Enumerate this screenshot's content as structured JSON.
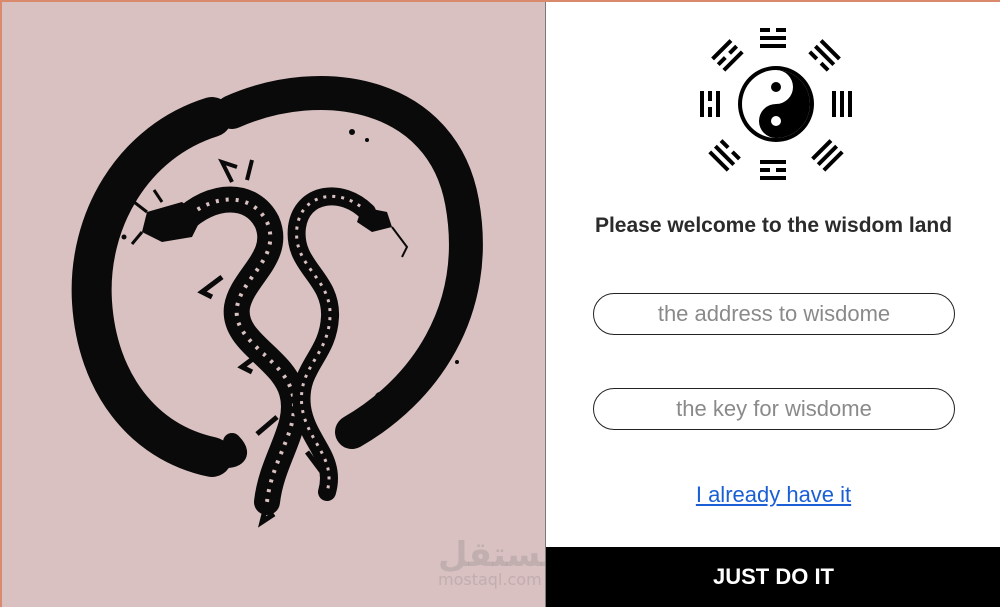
{
  "hero": {
    "illustration_icon": "enso-dragon-icon"
  },
  "watermark": {
    "main": "مستقل",
    "sub": "mostaql.com"
  },
  "emblem": {
    "icon": "bagua-yin-yang-icon"
  },
  "welcome_text": "Please welcome to the wisdom land",
  "form": {
    "address_placeholder": "the address to wisdome",
    "key_placeholder": "the key for wisdome",
    "already_link": "I already have it",
    "submit_label": "JUST DO IT"
  },
  "colors": {
    "left_background": "#d9c0c1",
    "frame_border": "#d98a6c",
    "link": "#1a5fd6",
    "button_bg": "#000000",
    "button_text": "#ffffff"
  }
}
